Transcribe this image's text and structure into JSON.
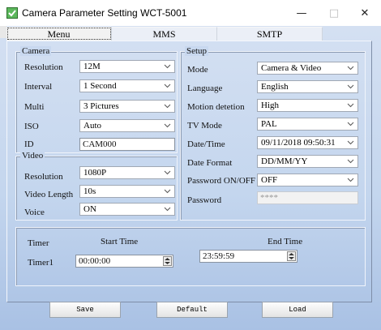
{
  "window": {
    "title": "Camera Parameter Setting WCT-5001",
    "minimize_glyph": "—",
    "maximize_glyph": "□",
    "close_glyph": "✕",
    "icon": "camera-app-icon"
  },
  "tabs": [
    {
      "label": "Menu",
      "active": true
    },
    {
      "label": "MMS",
      "active": false
    },
    {
      "label": "SMTP",
      "active": false
    }
  ],
  "camera": {
    "title": "Camera",
    "resolution": {
      "label": "Resolution",
      "value": "12M"
    },
    "interval": {
      "label": "Interval",
      "value": "1 Second"
    },
    "multi": {
      "label": "Multi",
      "value": "3 Pictures"
    },
    "iso": {
      "label": "ISO",
      "value": "Auto"
    },
    "id": {
      "label": "ID",
      "value": "CAM000"
    }
  },
  "video": {
    "title": "Video",
    "resolution": {
      "label": "Resolution",
      "value": "1080P"
    },
    "length": {
      "label": "Video Length",
      "value": "10s"
    },
    "voice": {
      "label": "Voice",
      "value": "ON"
    }
  },
  "setup": {
    "title": "Setup",
    "mode": {
      "label": "Mode",
      "value": "Camera & Video"
    },
    "language": {
      "label": "Language",
      "value": "English"
    },
    "motion": {
      "label": "Motion detetion",
      "value": "High"
    },
    "tv_mode": {
      "label": "TV Mode",
      "value": "PAL"
    },
    "datetime": {
      "label": "Date/Time",
      "value": "09/11/2018 09:50:31"
    },
    "date_format": {
      "label": "Date Format",
      "value": "DD/MM/YY"
    },
    "password_onoff": {
      "label": "Password ON/OFF",
      "value": "OFF"
    },
    "password": {
      "label": "Password",
      "value": "****"
    }
  },
  "timer": {
    "label": "Timer",
    "start_header": "Start Time",
    "end_header": "End Time",
    "row_label": "Timer1",
    "start_value": "00:00:00",
    "end_value": "23:59:59"
  },
  "buttons": {
    "save": "Save",
    "default": "Default",
    "load": "Load"
  },
  "colors": {
    "background_top": "#d4e0f2",
    "background_bottom": "#a9c1e4",
    "icon_green": "#5cb85c"
  }
}
